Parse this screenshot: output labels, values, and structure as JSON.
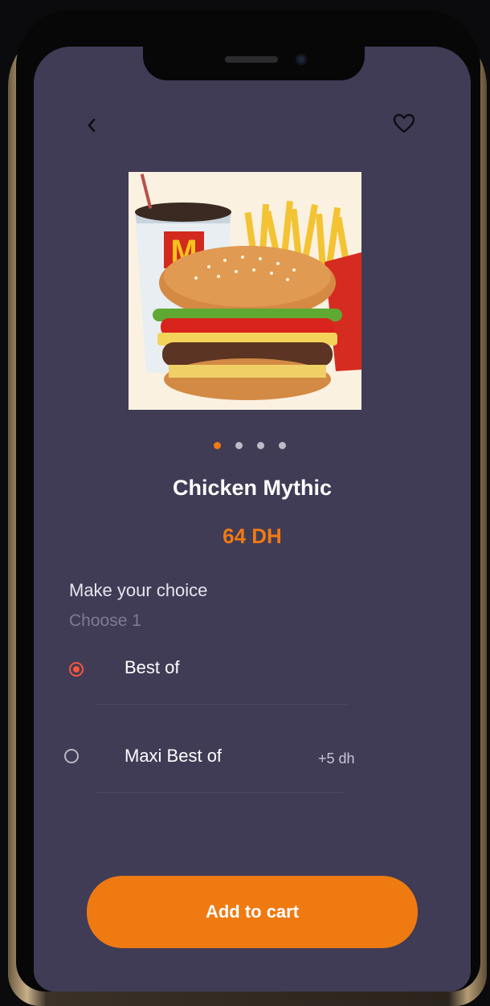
{
  "icons": {
    "back": "chevron-left-icon",
    "favorite": "heart-icon"
  },
  "product": {
    "image_alt": "Burger menu with drink and fries",
    "name": "Chicken Mythic",
    "price": "64 DH"
  },
  "carousel": {
    "count": 4,
    "active_index": 0
  },
  "choice": {
    "title": "Make your choice",
    "subtitle": "Choose 1",
    "options": [
      {
        "label": "Best of",
        "extra": "",
        "selected": true
      },
      {
        "label": "Maxi Best of",
        "extra": "+5 dh",
        "selected": false
      }
    ]
  },
  "actions": {
    "add_to_cart": "Add to cart"
  },
  "colors": {
    "background": "#403c56",
    "accent": "#f07a12",
    "radio_selected": "#f4573d",
    "text": "#ffffff"
  }
}
